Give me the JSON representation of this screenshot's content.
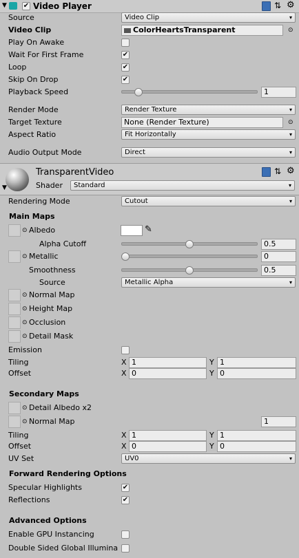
{
  "video_player": {
    "title": "Video Player",
    "source_label": "Source",
    "source_value": "Video Clip",
    "video_clip_label": "Video Clip",
    "video_clip_value": "ColorHeartsTransparent",
    "play_on_awake_label": "Play On Awake",
    "wait_first_frame_label": "Wait For First Frame",
    "loop_label": "Loop",
    "skip_on_drop_label": "Skip On Drop",
    "playback_speed_label": "Playback Speed",
    "playback_speed_value": "1",
    "render_mode_label": "Render Mode",
    "render_mode_value": "Render Texture",
    "target_texture_label": "Target Texture",
    "target_texture_value": "None (Render Texture)",
    "aspect_ratio_label": "Aspect Ratio",
    "aspect_ratio_value": "Fit Horizontally",
    "audio_output_label": "Audio Output Mode",
    "audio_output_value": "Direct"
  },
  "material": {
    "name": "TransparentVideo",
    "shader_label": "Shader",
    "shader_value": "Standard",
    "rendering_mode_label": "Rendering Mode",
    "rendering_mode_value": "Cutout",
    "main_maps_title": "Main Maps",
    "albedo_label": "Albedo",
    "alpha_cutoff_label": "Alpha Cutoff",
    "alpha_cutoff_value": "0.5",
    "metallic_label": "Metallic",
    "metallic_value": "0",
    "smoothness_label": "Smoothness",
    "smoothness_value": "0.5",
    "source_label": "Source",
    "source_value": "Metallic Alpha",
    "normal_map_label": "Normal Map",
    "height_map_label": "Height Map",
    "occlusion_label": "Occlusion",
    "detail_mask_label": "Detail Mask",
    "emission_label": "Emission",
    "tiling_label": "Tiling",
    "tiling_x": "1",
    "tiling_y": "1",
    "offset_label": "Offset",
    "offset_x": "0",
    "offset_y": "0",
    "x_label": "X",
    "y_label": "Y",
    "secondary_maps_title": "Secondary Maps",
    "detail_albedo_label": "Detail Albedo x2",
    "sec_normal_map_label": "Normal Map",
    "sec_normal_value": "1",
    "sec_tiling_label": "Tiling",
    "sec_tiling_x": "1",
    "sec_tiling_y": "1",
    "sec_offset_label": "Offset",
    "sec_offset_x": "0",
    "sec_offset_y": "0",
    "uv_set_label": "UV Set",
    "uv_set_value": "UV0",
    "forward_title": "Forward Rendering Options",
    "specular_label": "Specular Highlights",
    "reflections_label": "Reflections",
    "advanced_title": "Advanced Options",
    "gpu_instancing_label": "Enable GPU Instancing",
    "double_sided_label": "Double Sided Global Illumina"
  },
  "sliders": {
    "playback_speed": 0.1,
    "alpha_cutoff": 0.5,
    "metallic": 0.0,
    "smoothness": 0.5
  },
  "icons": {
    "checkmark": "✔",
    "dropdown_arrow": "▾",
    "object_picker": "⊙",
    "gear": "⚙"
  }
}
